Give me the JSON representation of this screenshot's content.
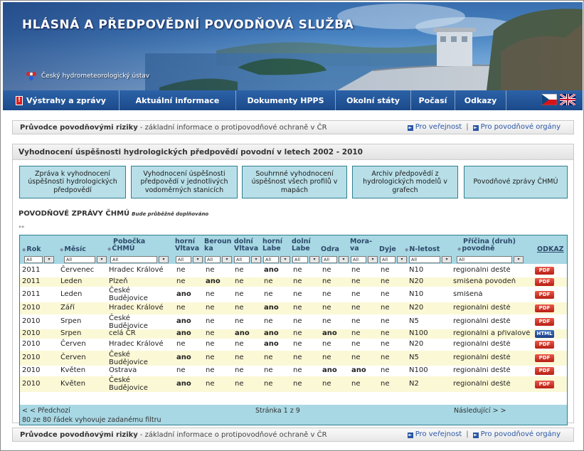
{
  "banner": {
    "title": "HLÁSNÁ A PŘEDPOVĚDNÍ POVODŇOVÁ SLUŽBA",
    "org": "Český hydrometeorologický ústav"
  },
  "nav": {
    "items": [
      "Výstrahy a zprávy",
      "Aktuální informace",
      "Dokumenty HPPS",
      "Okolní státy",
      "Počasí",
      "Odkazy"
    ]
  },
  "infobar": {
    "title": "Průvodce povodňovými riziky",
    "desc": "- základní informace o protipovodňové ochraně v ČR",
    "link_public": "Pro veřejnost",
    "link_authorities": "Pro povodňové orgány",
    "separator": "|"
  },
  "panel": {
    "heading": "Vyhodnocení úspěšnosti hydrologických předpovědí povodní v letech 2002 - 2010",
    "buttons": [
      "Zpráva k vyhodnocení úspěšnosti hydrologických předpovědí",
      "Vyhodnocení úspěšnosti předpovědí v jednotlivých vodoměrných stanicích",
      "Souhrnné vyhodnocení úspěšnost všech profilů v mapách",
      "Archiv předpovědí z hydrologických modelů v grafech",
      "Povodňové zprávy ČHMÚ"
    ],
    "section_title": "POVODŇOVÉ ZPRÁVY ČHMÚ",
    "section_note": "Bude průběžně doplňováno",
    "quotes": "\"\""
  },
  "table": {
    "headers": {
      "rok": "Rok",
      "mesic": "Měsíc",
      "pobocka_1": "Pobočka",
      "pobocka_2": "ČHMÚ",
      "horni_vltava_1": "horní",
      "horni_vltava_2": "Vltava",
      "berounka_1": "Beroun",
      "berounka_2": "ka",
      "dolni_vltava_1": "dolní",
      "dolni_vltava_2": "Vltava",
      "horni_labe_1": "horní",
      "horni_labe_2": "Labe",
      "dolni_labe_1": "dolní",
      "dolni_labe_2": "Labe",
      "odra": "Odra",
      "morava_1": "Mora-",
      "morava_2": "va",
      "dyje": "Dyje",
      "nletost": "N-letost",
      "pricina_1": "Příčina (druh)",
      "pricina_2": "povodně",
      "odkaz": "ODKAZ"
    },
    "filter_value": "All",
    "rows": [
      {
        "rok": "2011",
        "mesic": "Červenec",
        "pobocka": "Hradec Králové",
        "pobocka2": "",
        "hv": "ne",
        "be": "ne",
        "dv": "ne",
        "hl": "ano",
        "dl": "ne",
        "od": "ne",
        "mo": "ne",
        "dy": "ne",
        "nl": "N10",
        "pr": "regionální deště",
        "link": "PDF"
      },
      {
        "rok": "2011",
        "mesic": "Leden",
        "pobocka": "Plzeň",
        "pobocka2": "",
        "hv": "ne",
        "be": "ano",
        "dv": "ne",
        "hl": "ne",
        "dl": "ne",
        "od": "ne",
        "mo": "ne",
        "dy": "ne",
        "nl": "N20",
        "pr": "smíšená povodeň",
        "link": "PDF"
      },
      {
        "rok": "2011",
        "mesic": "Leden",
        "pobocka": "České",
        "pobocka2": "Budějovice",
        "hv": "ano",
        "be": "ne",
        "dv": "ne",
        "hl": "ne",
        "dl": "ne",
        "od": "ne",
        "mo": "ne",
        "dy": "ne",
        "nl": "N10",
        "pr": "smíšená",
        "link": "PDF"
      },
      {
        "rok": "2010",
        "mesic": "Září",
        "pobocka": "Hradec Králové",
        "pobocka2": "",
        "hv": "ne",
        "be": "ne",
        "dv": "ne",
        "hl": "ano",
        "dl": "ne",
        "od": "ne",
        "mo": "ne",
        "dy": "ne",
        "nl": "N20",
        "pr": "regionální deště",
        "link": "PDF"
      },
      {
        "rok": "2010",
        "mesic": "Srpen",
        "pobocka": "České",
        "pobocka2": "Budějovice",
        "hv": "ano",
        "be": "ne",
        "dv": "ne",
        "hl": "ne",
        "dl": "ne",
        "od": "ne",
        "mo": "ne",
        "dy": "ne",
        "nl": "N5",
        "pr": "regionální deště",
        "link": "PDF"
      },
      {
        "rok": "2010",
        "mesic": "Srpen",
        "pobocka": "celá ČR",
        "pobocka2": "",
        "hv": "ano",
        "be": "ne",
        "dv": "ano",
        "hl": "ano",
        "dl": "ne",
        "od": "ano",
        "mo": "ne",
        "dy": "ne",
        "nl": "N100",
        "pr": "regionální a přívalové",
        "link": "HTML"
      },
      {
        "rok": "2010",
        "mesic": "Červen",
        "pobocka": "Hradec Králové",
        "pobocka2": "",
        "hv": "ne",
        "be": "ne",
        "dv": "ne",
        "hl": "ano",
        "dl": "ne",
        "od": "ne",
        "mo": "ne",
        "dy": "ne",
        "nl": "N20",
        "pr": "regionální deště",
        "link": "PDF"
      },
      {
        "rok": "2010",
        "mesic": "Červen",
        "pobocka": "České",
        "pobocka2": "Budějovice",
        "hv": "ano",
        "be": "ne",
        "dv": "ne",
        "hl": "ne",
        "dl": "ne",
        "od": "ne",
        "mo": "ne",
        "dy": "ne",
        "nl": "N5",
        "pr": "regionální deště",
        "link": "PDF"
      },
      {
        "rok": "2010",
        "mesic": "Květen",
        "pobocka": "Ostrava",
        "pobocka2": "",
        "hv": "ne",
        "be": "ne",
        "dv": "ne",
        "hl": "ne",
        "dl": "ne",
        "od": "ano",
        "mo": "ano",
        "dy": "ne",
        "nl": "N100",
        "pr": "regionální deště",
        "link": "PDF"
      },
      {
        "rok": "2010",
        "mesic": "Květen",
        "pobocka": "České",
        "pobocka2": "Budějovice",
        "hv": "ano",
        "be": "ne",
        "dv": "ne",
        "hl": "ne",
        "dl": "ne",
        "od": "ne",
        "mo": "ne",
        "dy": "ne",
        "nl": "N2",
        "pr": "regionální deště",
        "link": "PDF"
      }
    ],
    "footer": {
      "prev": "< < Předchozí",
      "pager": "Stránka 1 z 9",
      "next": "Následující > >",
      "count": "80 ze 80 řádek vyhovuje zadanému filtru"
    }
  },
  "colors": {
    "nav_bg": "#1b4a8a",
    "table_header_bg": "#a8d8e4",
    "button_bg": "#b8dfe8",
    "row_alt_bg": "#fbf8d6",
    "link_blue": "#2a56a6"
  }
}
